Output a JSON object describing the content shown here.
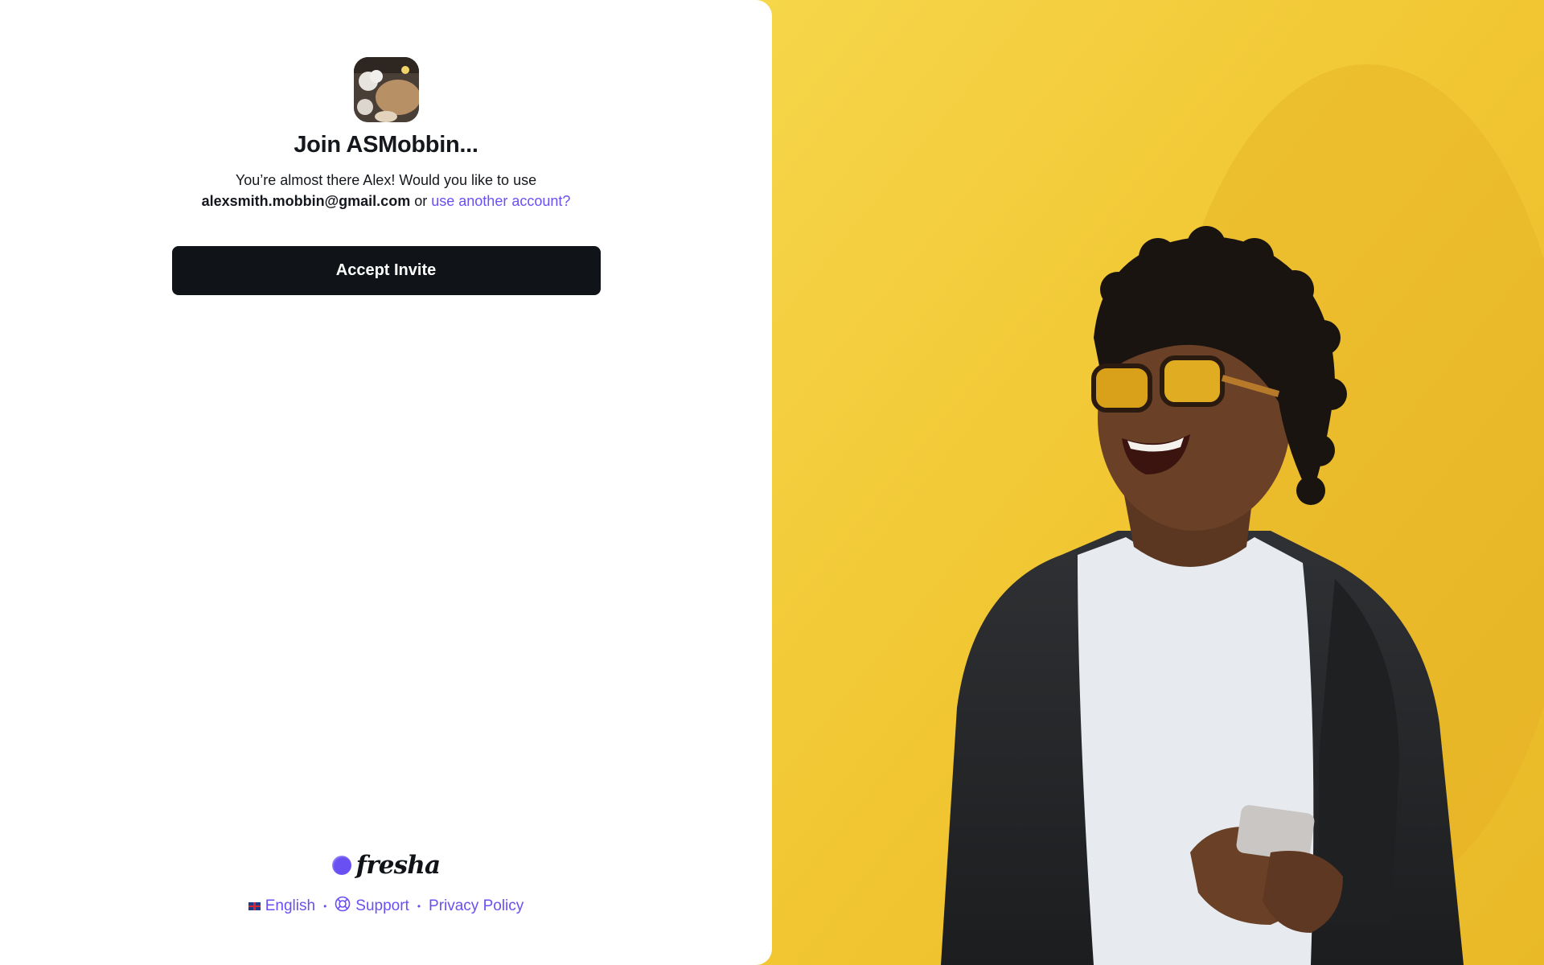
{
  "invite": {
    "title": "Join ASMobbin...",
    "subtitle_line1": "You’re almost there Alex! Would you like to use",
    "email": "alexsmith.mobbin@gmail.com",
    "or_text": "or",
    "alt_account_link": "use another account?",
    "accept_button": "Accept Invite"
  },
  "footer": {
    "brand": "fresha",
    "language": "English",
    "support": "Support",
    "privacy": "Privacy Policy",
    "separator": "•"
  },
  "colors": {
    "accent": "#6950f3",
    "button": "#101419",
    "photo_background": "#f3c93a"
  },
  "icons": {
    "flag": "uk-flag-icon",
    "support": "lifebuoy-icon",
    "brand": "fresha-logo-icon"
  }
}
